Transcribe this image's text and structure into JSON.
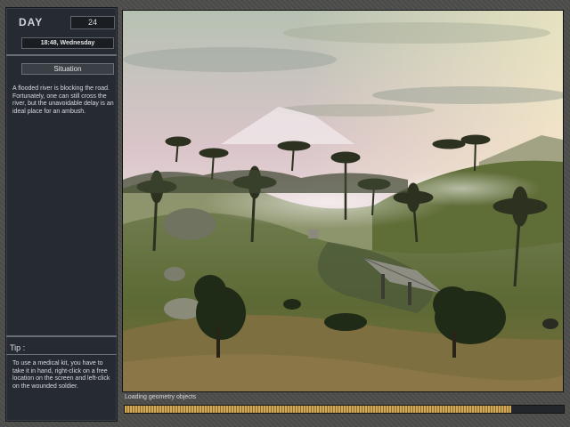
{
  "hud": {
    "day_label": "DAY",
    "day_number": "24",
    "datetime": "18:48, Wednesday",
    "situation_title": "Situation",
    "situation_text": "A flooded river is blocking the road. Fortunately, one can still cross the river, but the unavoidable delay is an ideal place for an ambush.",
    "tip_title": "Tip :",
    "tip_text": "To use a medical kit, you have to take it in hand, right-click on a free location on the screen and left-click on the wounded soldier."
  },
  "loading": {
    "status_text": "Loading geometry objects",
    "progress": 0.88
  },
  "colors": {
    "panel_bg": "#262a33",
    "frame_gray": "#4d4d4b",
    "progress_gold": "#d1a95a"
  }
}
